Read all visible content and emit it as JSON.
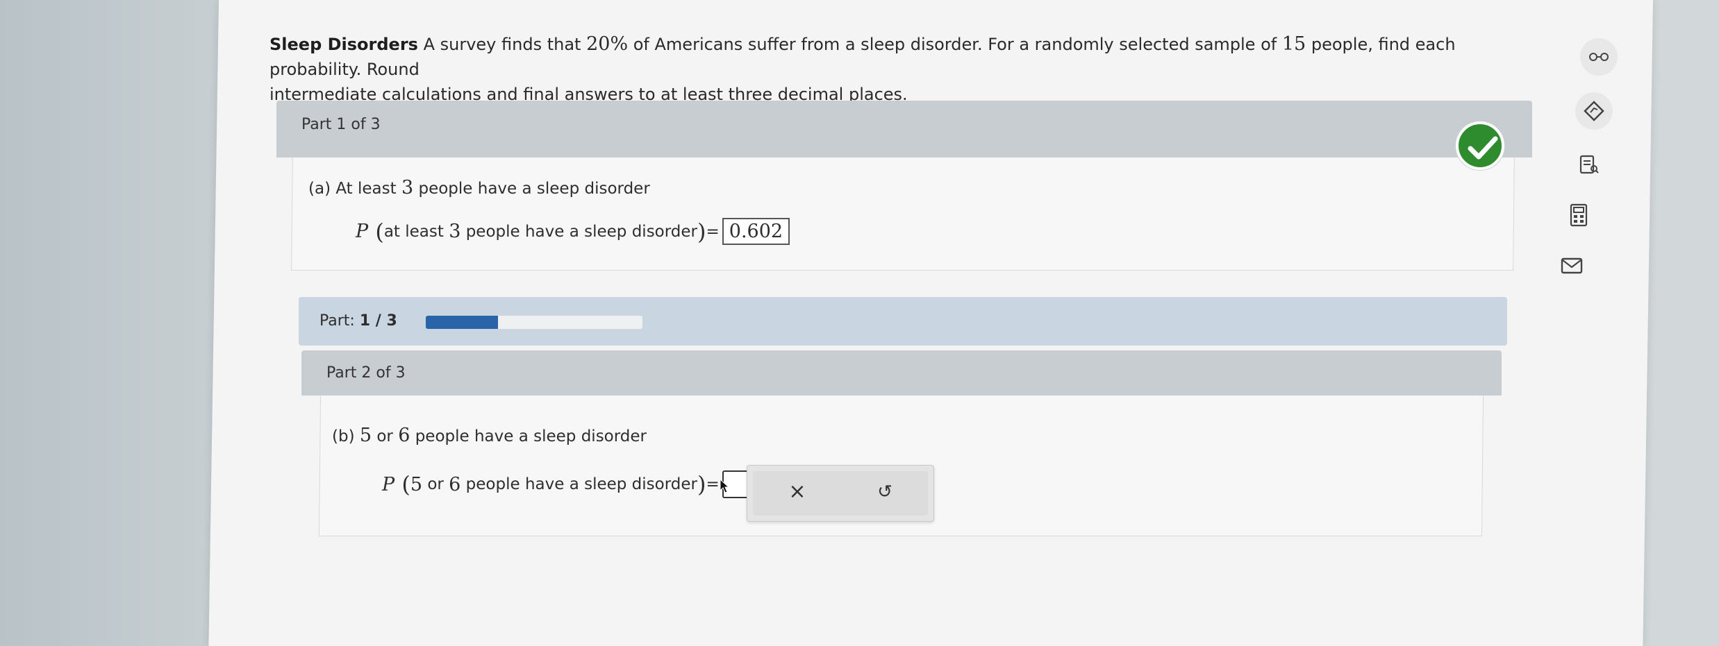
{
  "problem": {
    "title": "Sleep Disorders",
    "text_a": "A survey finds that",
    "percent": "20%",
    "text_b": "of Americans suffer from a sleep disorder. For a randomly selected sample of",
    "sample_size": "15",
    "text_c": "people, find each probability. Round",
    "text_d": "intermediate calculations and final answers to at least three decimal places."
  },
  "part1": {
    "header": "Part 1 of 3",
    "question_prefix": "(a) At least",
    "question_num": "3",
    "question_suffix": "people have a sleep disorder",
    "prob_symbol": "P",
    "prob_event_prefix": "at least",
    "prob_event_num": "3",
    "prob_event_suffix": "people have a sleep disorder",
    "equals": "=",
    "answer": "0.602",
    "status": "correct"
  },
  "progress": {
    "label": "Part:",
    "value": "1 / 3",
    "fraction": 0.333
  },
  "part2": {
    "header": "Part 2 of 3",
    "question_prefix": "(b)",
    "question_num1": "5",
    "question_or": "or",
    "question_num2": "6",
    "question_suffix": "people have a sleep disorder",
    "prob_symbol": "P",
    "prob_num1": "5",
    "prob_or": "or",
    "prob_num2": "6",
    "prob_suffix": "people have a sleep disorder",
    "equals": "=",
    "answer": ""
  },
  "toolbar": {
    "clear_glyph": "×",
    "undo_glyph": "↺"
  },
  "sidebar": {
    "icons": [
      "glasses-icon",
      "compass-icon",
      "notes-icon",
      "calculator-icon",
      "mail-icon"
    ]
  },
  "colors": {
    "correct_green": "#2e8b2e",
    "progress_blue": "#2a64a8",
    "part_header_gray": "#c8cdd1",
    "progress_row_blue": "#c9d5e0"
  }
}
